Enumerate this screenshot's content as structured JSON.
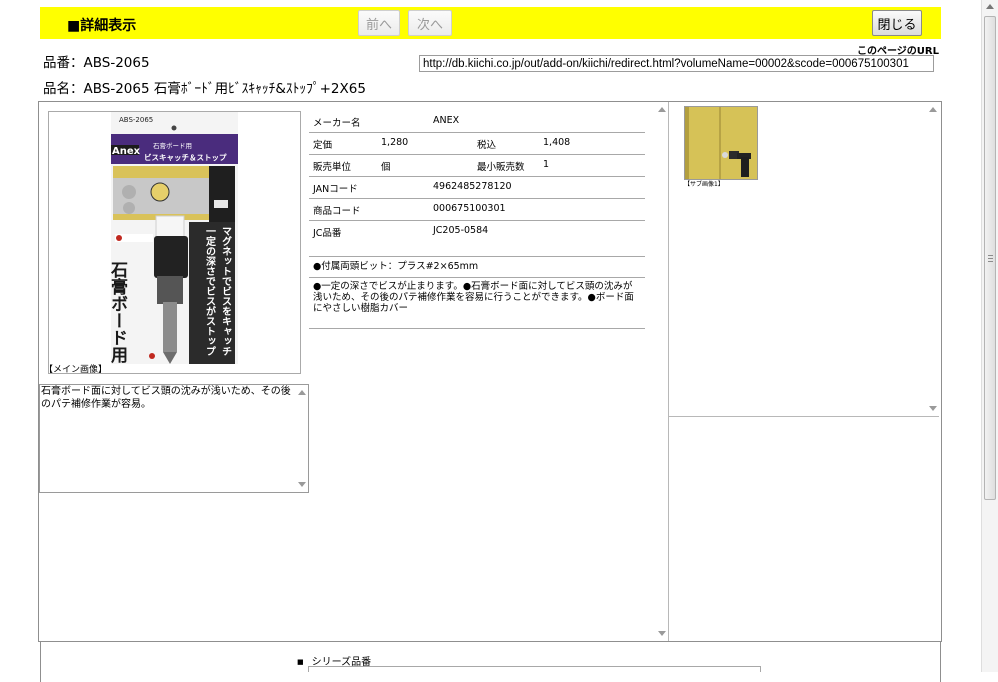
{
  "header": {
    "title": "■詳細表示",
    "prev_label": "前へ",
    "next_label": "次へ",
    "close_label": "閉じる"
  },
  "page_url": {
    "label": "このページのURL",
    "value": "http://db.kiichi.co.jp/out/add-on/kiichi/redirect.html?volumeName=00002&scode=000675100301"
  },
  "product": {
    "code_line": "品番：ABS-2065",
    "name_line": "品名：ABS-2065 石膏ﾎﾞｰﾄﾞ用ﾋﾞｽｷｬｯﾁ&ｽﾄｯﾌﾟ+2X65"
  },
  "main_image": {
    "caption": "【メイン画像】",
    "package_model": "ABS-2065",
    "brand": "Anex",
    "band_line1": "石膏ボード用",
    "band_line2": "ビスキャッチ＆ストップ",
    "vertical_text1": "マグネットでビスをキャッチ",
    "vertical_text2": "一定の深さでビスがストップ",
    "big_text": "石膏ボード用"
  },
  "description": "石膏ボード面に対してビス頭の沈みが浅いため、その後のパテ補修作業が容易。",
  "specs": {
    "maker_label": "メーカー名",
    "maker_value": "ANEX",
    "list_price_label": "定価",
    "list_price_value": "1,280",
    "tax_incl_label": "税込",
    "tax_incl_value": "1,408",
    "unit_label": "販売単位",
    "unit_value": "個",
    "min_qty_label": "最小販売数",
    "min_qty_value": "1",
    "jan_label": "JANコード",
    "jan_value": "4962485278120",
    "product_code_label": "商品コード",
    "product_code_value": "000675100301",
    "jc_label": "JC品番",
    "jc_value": "JC205-0584",
    "accessory": "●付属両頭ビット：プラス#2×65mm",
    "features": "●一定の深さでビスが止まります。●石膏ボード面に対してビス頭の沈みが浅いため、その後のパテ補修作業を容易に行うことができます。●ボード面にやさしい樹脂カバー"
  },
  "sub_image": {
    "caption": "【サブ画像1】"
  },
  "series": {
    "label": "シリーズ品番"
  },
  "colors": {
    "header_yellow": "#ffff00",
    "package_purple": "#4a2c7d",
    "panel_beige": "#d9c25a"
  }
}
